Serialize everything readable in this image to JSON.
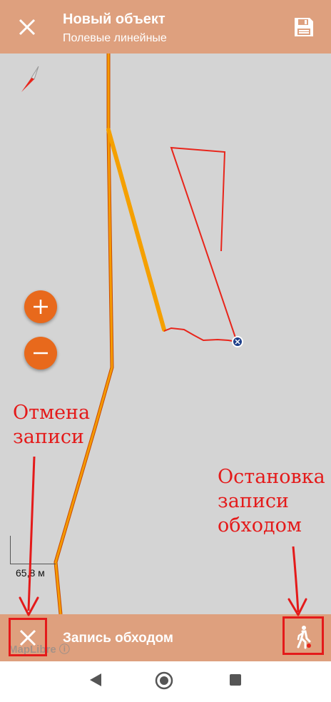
{
  "header": {
    "title": "Новый объект",
    "subtitle": "Полевые линейные",
    "close_icon": "close-icon",
    "save_icon": "save-icon"
  },
  "map": {
    "scale_label": "65,8 м",
    "zoom_in_icon": "plus-icon",
    "zoom_out_icon": "minus-icon",
    "attribution": "MapLibre"
  },
  "annotations": {
    "cancel_line1": "Отмена",
    "cancel_line2": "записи",
    "stop_line1": "Остановка",
    "stop_line2": "записи",
    "stop_line3": "обходом"
  },
  "bottom_bar": {
    "label": "Запись обходом",
    "cancel_icon": "close-icon",
    "walk_icon": "walking-person-icon"
  },
  "colors": {
    "toolbar": "#dea07e",
    "accent": "#e8691c",
    "route_orange": "#f59b00",
    "annotation_red": "#e41a1a",
    "map_bg": "#d4d4d4"
  }
}
